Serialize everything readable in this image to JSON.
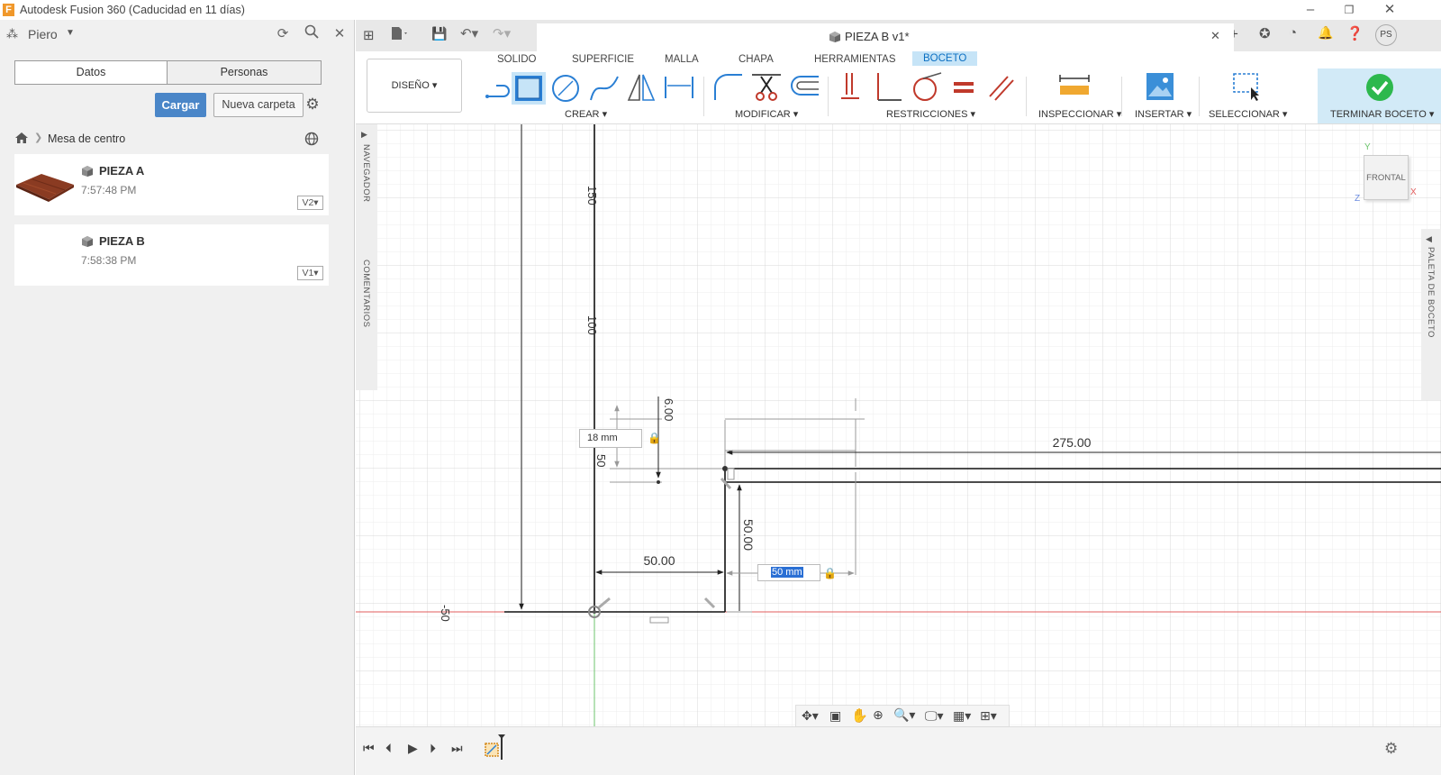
{
  "window": {
    "title": "Autodesk Fusion 360 (Caducidad en 11 días)",
    "app_icon": "F"
  },
  "left_panel": {
    "user": "Piero",
    "tabs": [
      "Datos",
      "Personas"
    ],
    "upload_label": "Cargar",
    "new_folder_label": "Nueva carpeta",
    "breadcrumb": "Mesa de centro",
    "files": [
      {
        "name": "PIEZA A",
        "time": "7:57:48 PM",
        "version": "V2"
      },
      {
        "name": "PIEZA B",
        "time": "7:58:38 PM",
        "version": "V1"
      }
    ]
  },
  "document": {
    "tab_title": "PIEZA B v1*",
    "user_initials": "PS"
  },
  "ribbon": {
    "tabs": [
      "SOLIDO",
      "SUPERFICIE",
      "MALLA",
      "CHAPA",
      "HERRAMIENTAS",
      "BOCETO"
    ],
    "active_tab": "BOCETO",
    "workspace": "DISEÑO",
    "groups": [
      "CREAR",
      "MODIFICAR",
      "RESTRICCIONES",
      "INSPECCIONAR",
      "INSERTAR",
      "SELECCIONAR",
      "TERMINAR BOCETO"
    ]
  },
  "side_panels": {
    "navigator": "NAVEGADOR",
    "comments": "COMENTARIOS",
    "sketch_palette": "PALETA DE BOCETO"
  },
  "viewcube": {
    "face": "FRONTAL",
    "axis_x": "X",
    "axis_y": "Y",
    "axis_z": "Z"
  },
  "sketch": {
    "ruler_labels": [
      "150",
      "100",
      "50",
      "-50"
    ],
    "dimensions": {
      "top_length": "275.00",
      "bottom_width": "50.00",
      "right_height": "50.00",
      "small_height": "6.00"
    },
    "inputs": {
      "thickness": "18 mm",
      "width_edit": "50 mm"
    }
  },
  "colors": {
    "accent_blue": "#4a86c8",
    "active_tab_bg": "#c6e4f7",
    "finish_bg": "#d2eaf7",
    "check_green": "#2db84d",
    "x_axis": "#e25c5c",
    "y_axis": "#6cc46c"
  }
}
